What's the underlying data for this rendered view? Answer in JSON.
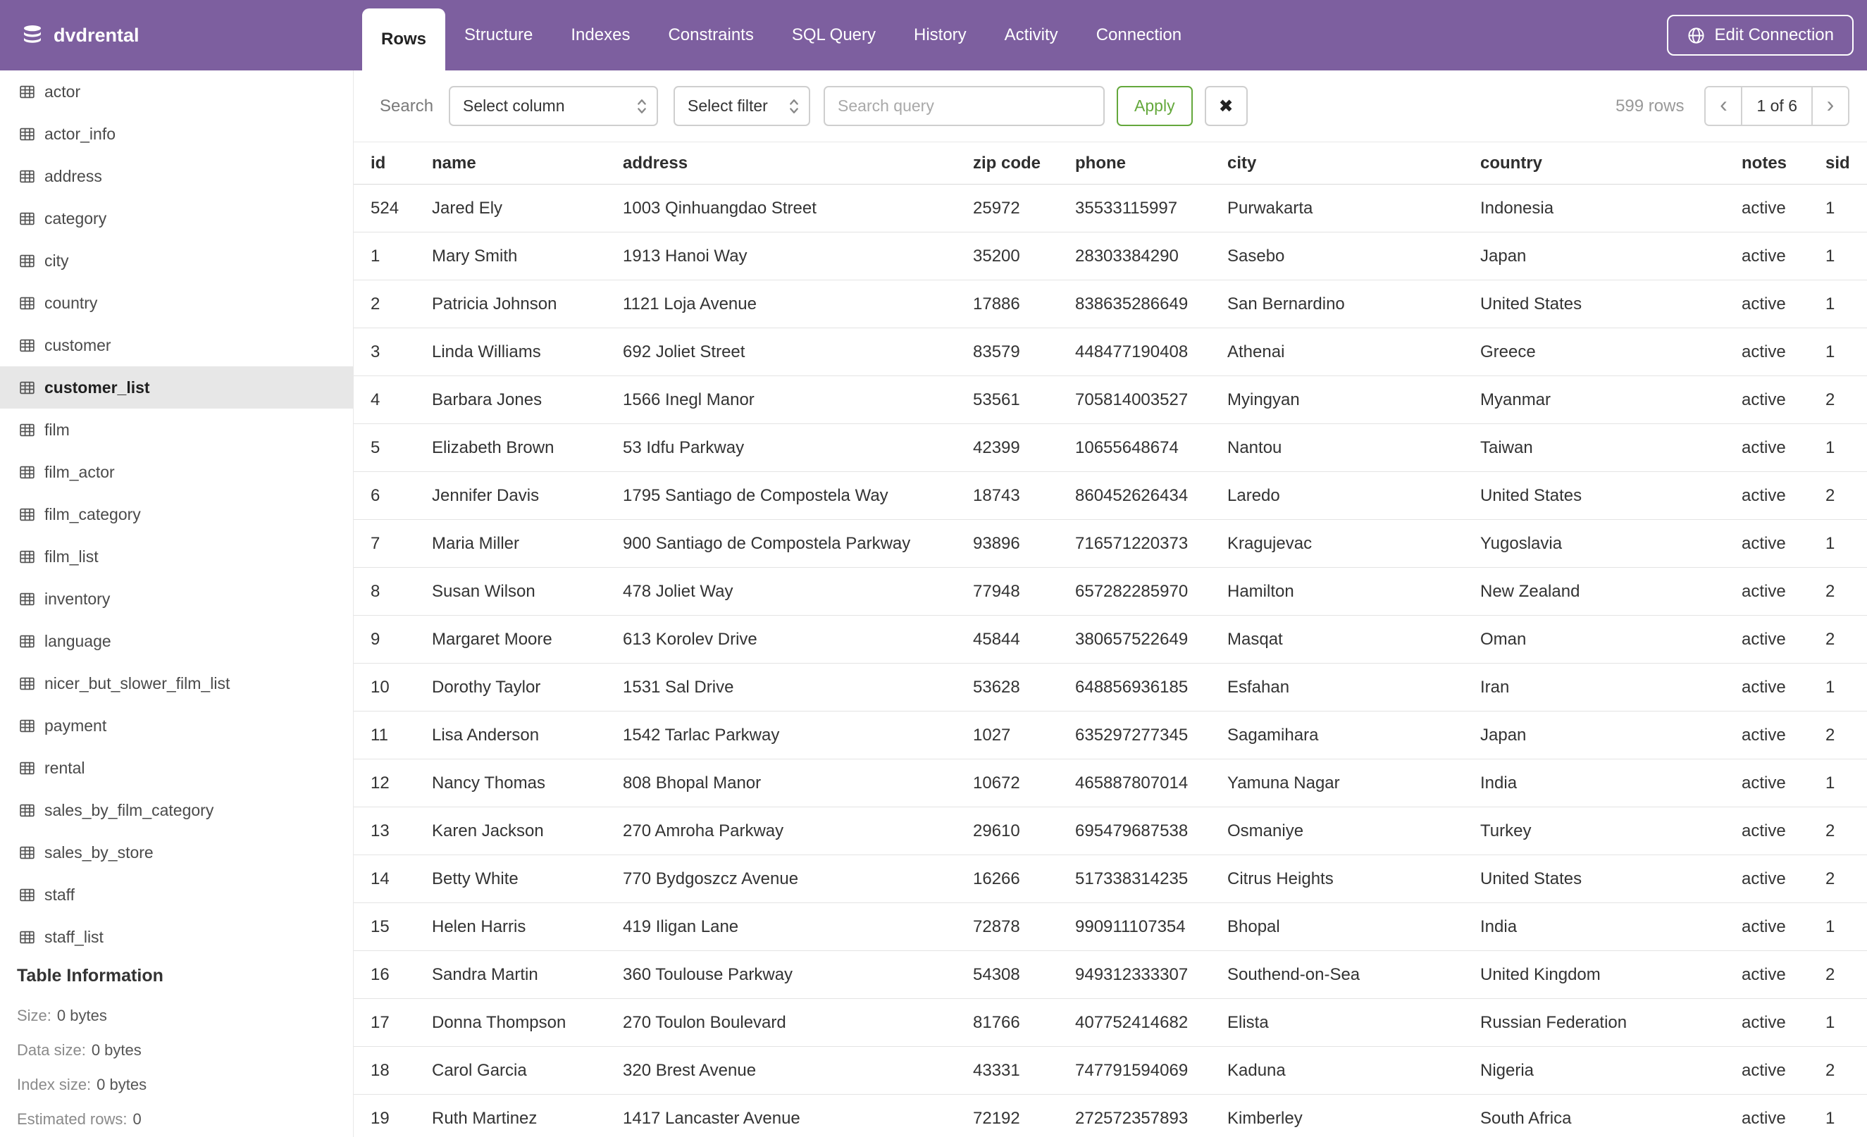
{
  "app": {
    "brand": "dvdrental",
    "edit_connection_label": "Edit Connection"
  },
  "tabs": [
    {
      "label": "Rows",
      "active": true
    },
    {
      "label": "Structure",
      "active": false
    },
    {
      "label": "Indexes",
      "active": false
    },
    {
      "label": "Constraints",
      "active": false
    },
    {
      "label": "SQL Query",
      "active": false
    },
    {
      "label": "History",
      "active": false
    },
    {
      "label": "Activity",
      "active": false
    },
    {
      "label": "Connection",
      "active": false
    }
  ],
  "sidebar": {
    "tables": [
      {
        "label": "actor",
        "selected": false
      },
      {
        "label": "actor_info",
        "selected": false
      },
      {
        "label": "address",
        "selected": false
      },
      {
        "label": "category",
        "selected": false
      },
      {
        "label": "city",
        "selected": false
      },
      {
        "label": "country",
        "selected": false
      },
      {
        "label": "customer",
        "selected": false
      },
      {
        "label": "customer_list",
        "selected": true
      },
      {
        "label": "film",
        "selected": false
      },
      {
        "label": "film_actor",
        "selected": false
      },
      {
        "label": "film_category",
        "selected": false
      },
      {
        "label": "film_list",
        "selected": false
      },
      {
        "label": "inventory",
        "selected": false
      },
      {
        "label": "language",
        "selected": false
      },
      {
        "label": "nicer_but_slower_film_list",
        "selected": false
      },
      {
        "label": "payment",
        "selected": false
      },
      {
        "label": "rental",
        "selected": false
      },
      {
        "label": "sales_by_film_category",
        "selected": false
      },
      {
        "label": "sales_by_store",
        "selected": false
      },
      {
        "label": "staff",
        "selected": false
      },
      {
        "label": "staff_list",
        "selected": false
      }
    ],
    "info": {
      "title": "Table Information",
      "items": [
        {
          "label": "Size:",
          "value": "0 bytes"
        },
        {
          "label": "Data size:",
          "value": "0 bytes"
        },
        {
          "label": "Index size:",
          "value": "0 bytes"
        },
        {
          "label": "Estimated rows:",
          "value": "0"
        }
      ]
    }
  },
  "toolbar": {
    "search_label": "Search",
    "column_select_value": "Select column",
    "filter_select_value": "Select filter",
    "query_placeholder": "Search query",
    "query_value": "",
    "apply_label": "Apply",
    "clear_icon": "✖",
    "row_count": "599 rows",
    "pagination": {
      "prev_icon": "‹",
      "page_label": "1 of 6",
      "next_icon": "›"
    }
  },
  "table": {
    "columns": [
      "id",
      "name",
      "address",
      "zip code",
      "phone",
      "city",
      "country",
      "notes",
      "sid"
    ],
    "rows": [
      [
        524,
        "Jared Ely",
        "1003 Qinhuangdao Street",
        "25972",
        "35533115997",
        "Purwakarta",
        "Indonesia",
        "active",
        1
      ],
      [
        1,
        "Mary Smith",
        "1913 Hanoi Way",
        "35200",
        "28303384290",
        "Sasebo",
        "Japan",
        "active",
        1
      ],
      [
        2,
        "Patricia Johnson",
        "1121 Loja Avenue",
        "17886",
        "838635286649",
        "San Bernardino",
        "United States",
        "active",
        1
      ],
      [
        3,
        "Linda Williams",
        "692 Joliet Street",
        "83579",
        "448477190408",
        "Athenai",
        "Greece",
        "active",
        1
      ],
      [
        4,
        "Barbara Jones",
        "1566 Inegl Manor",
        "53561",
        "705814003527",
        "Myingyan",
        "Myanmar",
        "active",
        2
      ],
      [
        5,
        "Elizabeth Brown",
        "53 Idfu Parkway",
        "42399",
        "10655648674",
        "Nantou",
        "Taiwan",
        "active",
        1
      ],
      [
        6,
        "Jennifer Davis",
        "1795 Santiago de Compostela Way",
        "18743",
        "860452626434",
        "Laredo",
        "United States",
        "active",
        2
      ],
      [
        7,
        "Maria Miller",
        "900 Santiago de Compostela Parkway",
        "93896",
        "716571220373",
        "Kragujevac",
        "Yugoslavia",
        "active",
        1
      ],
      [
        8,
        "Susan Wilson",
        "478 Joliet Way",
        "77948",
        "657282285970",
        "Hamilton",
        "New Zealand",
        "active",
        2
      ],
      [
        9,
        "Margaret Moore",
        "613 Korolev Drive",
        "45844",
        "380657522649",
        "Masqat",
        "Oman",
        "active",
        2
      ],
      [
        10,
        "Dorothy Taylor",
        "1531 Sal Drive",
        "53628",
        "648856936185",
        "Esfahan",
        "Iran",
        "active",
        1
      ],
      [
        11,
        "Lisa Anderson",
        "1542 Tarlac Parkway",
        "1027",
        "635297277345",
        "Sagamihara",
        "Japan",
        "active",
        2
      ],
      [
        12,
        "Nancy Thomas",
        "808 Bhopal Manor",
        "10672",
        "465887807014",
        "Yamuna Nagar",
        "India",
        "active",
        1
      ],
      [
        13,
        "Karen Jackson",
        "270 Amroha Parkway",
        "29610",
        "695479687538",
        "Osmaniye",
        "Turkey",
        "active",
        2
      ],
      [
        14,
        "Betty White",
        "770 Bydgoszcz Avenue",
        "16266",
        "517338314235",
        "Citrus Heights",
        "United States",
        "active",
        2
      ],
      [
        15,
        "Helen Harris",
        "419 Iligan Lane",
        "72878",
        "990911107354",
        "Bhopal",
        "India",
        "active",
        1
      ],
      [
        16,
        "Sandra Martin",
        "360 Toulouse Parkway",
        "54308",
        "949312333307",
        "Southend-on-Sea",
        "United Kingdom",
        "active",
        2
      ],
      [
        17,
        "Donna Thompson",
        "270 Toulon Boulevard",
        "81766",
        "407752414682",
        "Elista",
        "Russian Federation",
        "active",
        1
      ],
      [
        18,
        "Carol Garcia",
        "320 Brest Avenue",
        "43331",
        "747791594069",
        "Kaduna",
        "Nigeria",
        "active",
        2
      ],
      [
        19,
        "Ruth Martinez",
        "1417 Lancaster Avenue",
        "72192",
        "272572357893",
        "Kimberley",
        "South Africa",
        "active",
        1
      ]
    ]
  },
  "colors": {
    "header_purple": "#7d5f9f",
    "apply_green": "#64a83c",
    "selected_item_bg": "#e7e7e7"
  }
}
